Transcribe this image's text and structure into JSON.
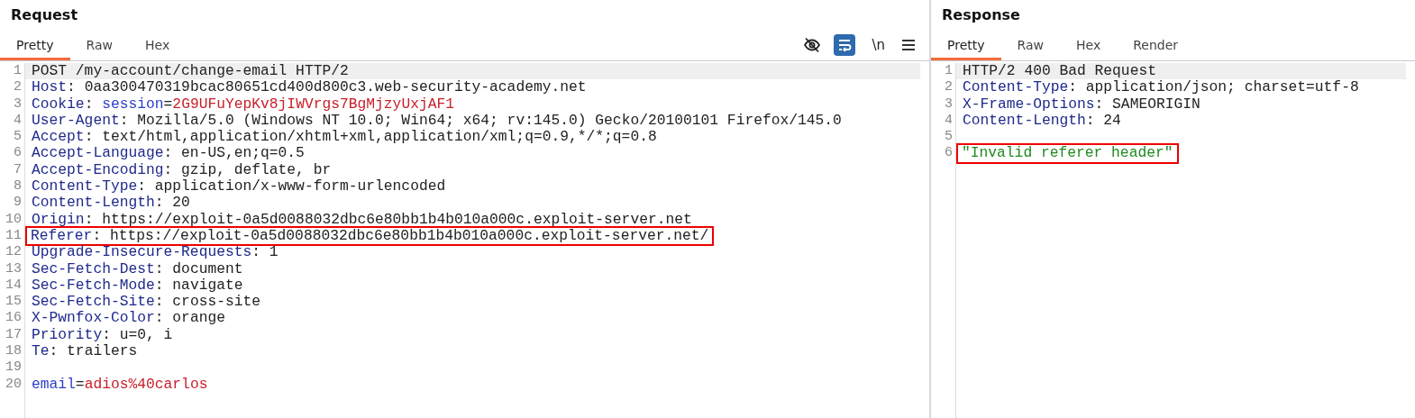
{
  "request": {
    "title": "Request",
    "tabs": [
      {
        "label": "Pretty",
        "selected": true
      },
      {
        "label": "Raw",
        "selected": false
      },
      {
        "label": "Hex",
        "selected": false
      }
    ],
    "toolbar": {
      "hide_toggle": {
        "on": false
      },
      "wrap_toggle": {
        "on": true
      },
      "newline_toggle": {
        "label": "\\n",
        "on": false
      }
    },
    "lines": [
      {
        "number": "1",
        "current": true,
        "segments": [
          {
            "kind": "plain",
            "text": "POST /my-account/change-email HTTP/2"
          }
        ]
      },
      {
        "number": "2",
        "current": false,
        "segments": [
          {
            "kind": "name",
            "text": "Host"
          },
          {
            "kind": "plain",
            "text": ": 0aa300470319bcac80651cd400d800c3.web-security-academy.net"
          }
        ]
      },
      {
        "number": "3",
        "current": false,
        "segments": [
          {
            "kind": "name",
            "text": "Cookie"
          },
          {
            "kind": "plain",
            "text": ": "
          },
          {
            "kind": "param",
            "text": "session"
          },
          {
            "kind": "plain",
            "text": "="
          },
          {
            "kind": "value",
            "text": "2G9UFuYepKv8jIWVrgs7BgMjzyUxjAF1"
          }
        ]
      },
      {
        "number": "4",
        "current": false,
        "segments": [
          {
            "kind": "name",
            "text": "User-Agent"
          },
          {
            "kind": "plain",
            "text": ": Mozilla/5.0 (Windows NT 10.0; Win64; x64; rv:145.0) Gecko/20100101 Firefox/145.0"
          }
        ]
      },
      {
        "number": "5",
        "current": false,
        "segments": [
          {
            "kind": "name",
            "text": "Accept"
          },
          {
            "kind": "plain",
            "text": ": text/html,application/xhtml+xml,application/xml;q=0.9,*/*;q=0.8"
          }
        ]
      },
      {
        "number": "6",
        "current": false,
        "segments": [
          {
            "kind": "name",
            "text": "Accept-Language"
          },
          {
            "kind": "plain",
            "text": ": en-US,en;q=0.5"
          }
        ]
      },
      {
        "number": "7",
        "current": false,
        "segments": [
          {
            "kind": "name",
            "text": "Accept-Encoding"
          },
          {
            "kind": "plain",
            "text": ": gzip, deflate, br"
          }
        ]
      },
      {
        "number": "8",
        "current": false,
        "segments": [
          {
            "kind": "name",
            "text": "Content-Type"
          },
          {
            "kind": "plain",
            "text": ": application/x-www-form-urlencoded"
          }
        ]
      },
      {
        "number": "9",
        "current": false,
        "segments": [
          {
            "kind": "name",
            "text": "Content-Length"
          },
          {
            "kind": "plain",
            "text": ": 20"
          }
        ]
      },
      {
        "number": "10",
        "current": false,
        "segments": [
          {
            "kind": "name",
            "text": "Origin"
          },
          {
            "kind": "plain",
            "text": ": https://exploit-0a5d0088032dbc6e80bb1b4b010a000c.exploit-server.net"
          }
        ]
      },
      {
        "number": "11",
        "current": false,
        "boxed": true,
        "segments": [
          {
            "kind": "name",
            "text": "Referer"
          },
          {
            "kind": "plain",
            "text": ": https://exploit-0a5d0088032dbc6e80bb1b4b010a000c.exploit-server.net/"
          }
        ]
      },
      {
        "number": "12",
        "current": false,
        "segments": [
          {
            "kind": "name",
            "text": "Upgrade-Insecure-Requests"
          },
          {
            "kind": "plain",
            "text": ": 1"
          }
        ]
      },
      {
        "number": "13",
        "current": false,
        "segments": [
          {
            "kind": "name",
            "text": "Sec-Fetch-Dest"
          },
          {
            "kind": "plain",
            "text": ": document"
          }
        ]
      },
      {
        "number": "14",
        "current": false,
        "segments": [
          {
            "kind": "name",
            "text": "Sec-Fetch-Mode"
          },
          {
            "kind": "plain",
            "text": ": navigate"
          }
        ]
      },
      {
        "number": "15",
        "current": false,
        "segments": [
          {
            "kind": "name",
            "text": "Sec-Fetch-Site"
          },
          {
            "kind": "plain",
            "text": ": cross-site"
          }
        ]
      },
      {
        "number": "16",
        "current": false,
        "segments": [
          {
            "kind": "name",
            "text": "X-Pwnfox-Color"
          },
          {
            "kind": "plain",
            "text": ": orange"
          }
        ]
      },
      {
        "number": "17",
        "current": false,
        "segments": [
          {
            "kind": "name",
            "text": "Priority"
          },
          {
            "kind": "plain",
            "text": ": u=0, i"
          }
        ]
      },
      {
        "number": "18",
        "current": false,
        "segments": [
          {
            "kind": "name",
            "text": "Te"
          },
          {
            "kind": "plain",
            "text": ": trailers"
          }
        ]
      },
      {
        "number": "19",
        "current": false
      },
      {
        "number": "20",
        "current": false,
        "segments": [
          {
            "kind": "param",
            "text": "email"
          },
          {
            "kind": "plain",
            "text": "="
          },
          {
            "kind": "value",
            "text": "adios%40carlos"
          }
        ]
      }
    ]
  },
  "response": {
    "title": "Response",
    "tabs": [
      {
        "label": "Pretty",
        "selected": true
      },
      {
        "label": "Raw",
        "selected": false
      },
      {
        "label": "Hex",
        "selected": false
      },
      {
        "label": "Render",
        "selected": false
      }
    ],
    "lines": [
      {
        "number": "1",
        "current": true,
        "segments": [
          {
            "kind": "plain",
            "text": "HTTP/2 400 Bad Request"
          }
        ]
      },
      {
        "number": "2",
        "current": false,
        "segments": [
          {
            "kind": "name",
            "text": "Content-Type"
          },
          {
            "kind": "plain",
            "text": ": application/json; charset=utf-8"
          }
        ]
      },
      {
        "number": "3",
        "current": false,
        "segments": [
          {
            "kind": "name",
            "text": "X-Frame-Options"
          },
          {
            "kind": "plain",
            "text": ": SAMEORIGIN"
          }
        ]
      },
      {
        "number": "4",
        "current": false,
        "segments": [
          {
            "kind": "name",
            "text": "Content-Length"
          },
          {
            "kind": "plain",
            "text": ": 24"
          }
        ]
      },
      {
        "number": "5",
        "current": false
      },
      {
        "number": "6",
        "current": false,
        "boxed": true,
        "segments": [
          {
            "kind": "string",
            "text": "\"Invalid referer header\""
          }
        ]
      }
    ]
  }
}
